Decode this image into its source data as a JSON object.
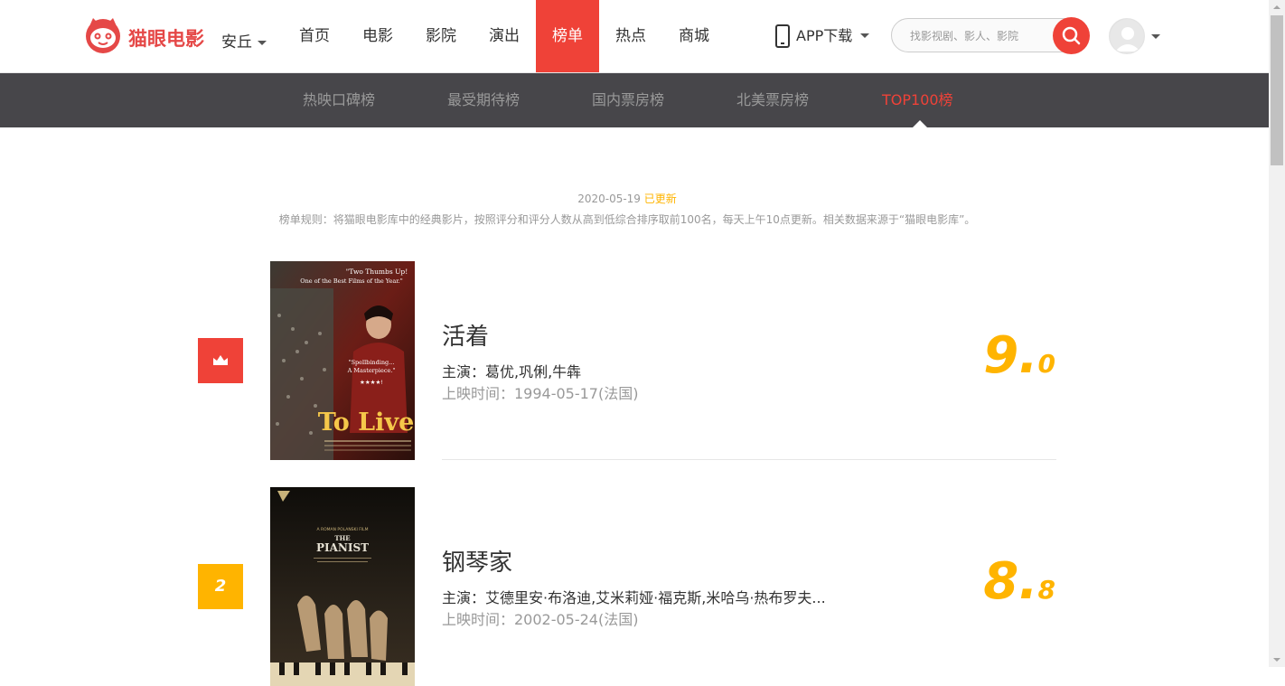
{
  "header": {
    "brand": "猫眼电影",
    "city": "安丘",
    "nav": [
      "首页",
      "电影",
      "影院",
      "演出",
      "榜单",
      "热点",
      "商城"
    ],
    "active_nav": "榜单",
    "app_download": "APP下载",
    "search_placeholder": "找影视剧、影人、影院",
    "accent_color": "#ef4238"
  },
  "subnav": {
    "items": [
      "热映口碑榜",
      "最受期待榜",
      "国内票房榜",
      "北美票房榜",
      "TOP100榜"
    ],
    "active": "TOP100榜"
  },
  "board": {
    "update_date": "2020-05-19",
    "update_status": "已更新",
    "rule": "榜单规则：将猫眼电影库中的经典影片，按照评分和评分人数从高到低综合排序取前100名，每天上午10点更新。相关数据来源于“猫眼电影库”。",
    "movies": [
      {
        "rank": "1",
        "rank_icon": "crown-icon",
        "title": "活着",
        "stars": "主演：葛优,巩俐,牛犇",
        "release": "上映时间：1994-05-17(法国)",
        "score_int": "9.",
        "score_frac": "0",
        "poster": {
          "quote1": "\"Two Thumbs Up!",
          "quote2": "One of the Best Films of the Year.\"",
          "quote3": "\"Spellbinding...",
          "quote4": "A Masterpiece.\"",
          "rating": "★★★★!",
          "title": "To Live"
        }
      },
      {
        "rank": "2",
        "title": "钢琴家",
        "stars": "主演：艾德里安·布洛迪,艾米莉娅·福克斯,米哈乌·热布罗夫...",
        "release": "上映时间：2002-05-24(法国)",
        "score_int": "8.",
        "score_frac": "8",
        "poster": {
          "credit": "A ROMAN POLANSKI FILM",
          "title_top": "THE",
          "title": "PIANIST"
        }
      }
    ]
  }
}
